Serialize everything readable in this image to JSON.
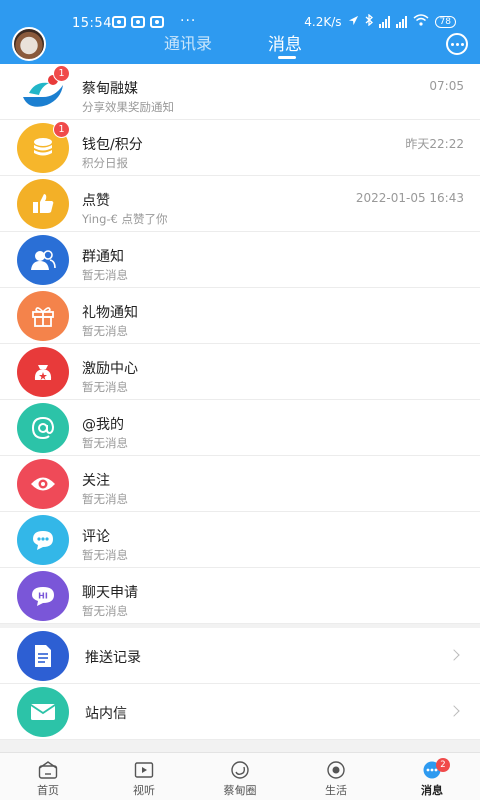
{
  "status_bar": {
    "time": "15:54",
    "dots": "···",
    "speed": "4.2K/s",
    "battery": "78"
  },
  "header": {
    "tabs": [
      {
        "label": "通讯录",
        "active": false
      },
      {
        "label": "消息",
        "active": true
      }
    ],
    "more_icon": "chat-bubble-dots-icon"
  },
  "messages": [
    {
      "title": "蔡甸融媒",
      "subtitle": "分享效果奖励通知",
      "time": "07:05",
      "badge": "1",
      "icon": "media-logo-icon"
    },
    {
      "title": "钱包/积分",
      "subtitle": "积分日报",
      "time": "昨天22:22",
      "badge": "1",
      "icon": "coins-icon"
    },
    {
      "title": "点赞",
      "subtitle": "Ying-€ 点赞了你",
      "time": "2022-01-05 16:43",
      "badge": "",
      "icon": "thumbs-up-icon"
    },
    {
      "title": "群通知",
      "subtitle": "暂无消息",
      "time": "",
      "badge": "",
      "icon": "group-icon"
    },
    {
      "title": "礼物通知",
      "subtitle": "暂无消息",
      "time": "",
      "badge": "",
      "icon": "gift-icon"
    },
    {
      "title": "激励中心",
      "subtitle": "暂无消息",
      "time": "",
      "badge": "",
      "icon": "reward-bag-icon"
    },
    {
      "title": "@我的",
      "subtitle": "暂无消息",
      "time": "",
      "badge": "",
      "icon": "at-icon"
    },
    {
      "title": "关注",
      "subtitle": "暂无消息",
      "time": "",
      "badge": "",
      "icon": "eye-icon"
    },
    {
      "title": "评论",
      "subtitle": "暂无消息",
      "time": "",
      "badge": "",
      "icon": "comment-icon"
    },
    {
      "title": "聊天申请",
      "subtitle": "暂无消息",
      "time": "",
      "badge": "",
      "icon": "hi-chat-icon"
    }
  ],
  "links": [
    {
      "title": "推送记录",
      "icon": "document-icon"
    },
    {
      "title": "站内信",
      "icon": "mail-icon"
    }
  ],
  "bottom_nav": {
    "items": [
      {
        "label": "首页",
        "icon": "home-icon"
      },
      {
        "label": "视听",
        "icon": "video-play-icon"
      },
      {
        "label": "蔡甸圈",
        "icon": "circle-logo-icon"
      },
      {
        "label": "生活",
        "icon": "life-icon"
      },
      {
        "label": "消息",
        "icon": "message-icon",
        "active": true
      }
    ],
    "message_badge": "2"
  },
  "colors": {
    "header_blue": "#2e9af0",
    "badge_red": "#f04a4a"
  }
}
